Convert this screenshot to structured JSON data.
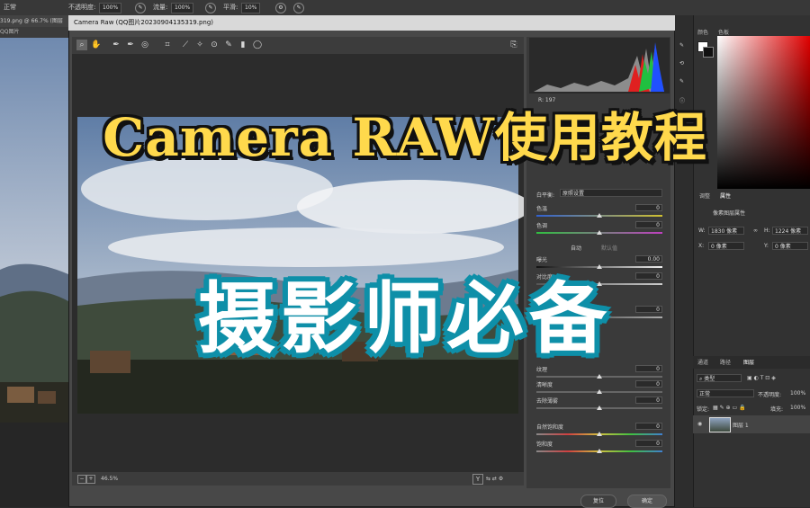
{
  "options_bar": {
    "mode": "正常",
    "opacity_label": "不透明度:",
    "opacity_value": "100%",
    "flow_label": "流量:",
    "flow_value": "100%",
    "smoothing_label": "平滑:",
    "smoothing_value": "10%"
  },
  "document": {
    "tab_label": "319.png @ 66.7% (图层",
    "tab_prefix": "QQ图片"
  },
  "camera_raw": {
    "title": "Camera Raw (QQ图片20230904135319.png)",
    "zoom": "46.5%",
    "readout_r": "R: 197",
    "panel_section": "基本",
    "white_balance_label": "白平衡:",
    "white_balance_value": "原照设置",
    "auto_label": "自动",
    "default_label": "默认值",
    "sliders": [
      {
        "label": "色温",
        "value": "0"
      },
      {
        "label": "色调",
        "value": "0"
      },
      {
        "label": "曝光",
        "value": "0.00"
      },
      {
        "label": "对比度",
        "value": "0"
      },
      {
        "label": "阴影",
        "value": "0"
      },
      {
        "label": "纹理",
        "value": "0"
      },
      {
        "label": "清晰度",
        "value": "0"
      },
      {
        "label": "去除薄雾",
        "value": "0"
      },
      {
        "label": "自然饱和度",
        "value": "0"
      },
      {
        "label": "饱和度",
        "value": "0"
      }
    ],
    "reset_button": "复位",
    "ok_button": "确定"
  },
  "ps_right": {
    "color_tab": "颜色",
    "swatches_tab": "色板",
    "adjust_tab": "调整",
    "properties_tab": "属性",
    "props_subtitle": "像素图层属性",
    "w_label": "W:",
    "w_value": "1830 像素",
    "h_label": "H:",
    "h_value": "1224 像素",
    "x_label": "X:",
    "x_value": "0 像素",
    "y_label": "Y:",
    "y_value": "0 像素",
    "channels_tab": "通道",
    "paths_tab": "路径",
    "layers_tab": "图层",
    "kind_label": "类型",
    "blend_mode": "正常",
    "opacity_label": "不透明度:",
    "opacity_value": "100%",
    "lock_label": "锁定:",
    "fill_label": "填充:",
    "fill_value": "100%",
    "layer_name": "图层 1"
  },
  "overlay": {
    "title": "Camera RAW使用教程",
    "subtitle": "摄影师必备"
  }
}
